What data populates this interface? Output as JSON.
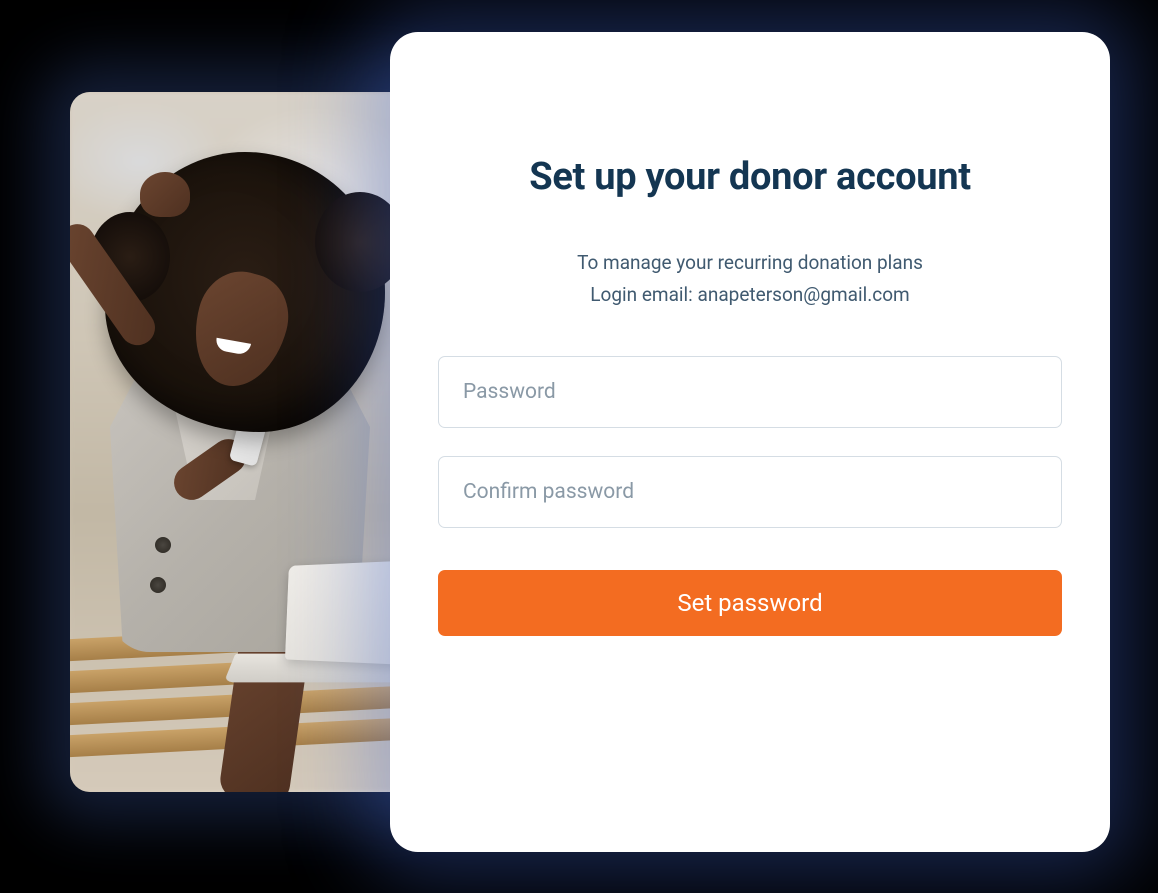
{
  "form": {
    "title": "Set up your donor account",
    "subtitle_line1": "To manage your recurring donation plans",
    "subtitle_line2_prefix": "Login email: ",
    "login_email": "anapeterson@gmail.com",
    "password_placeholder": "Password",
    "confirm_password_placeholder": "Confirm password",
    "submit_label": "Set password"
  },
  "colors": {
    "primary_button": "#f36c21",
    "title_text": "#143652",
    "card_glow": "#4a6edc"
  }
}
